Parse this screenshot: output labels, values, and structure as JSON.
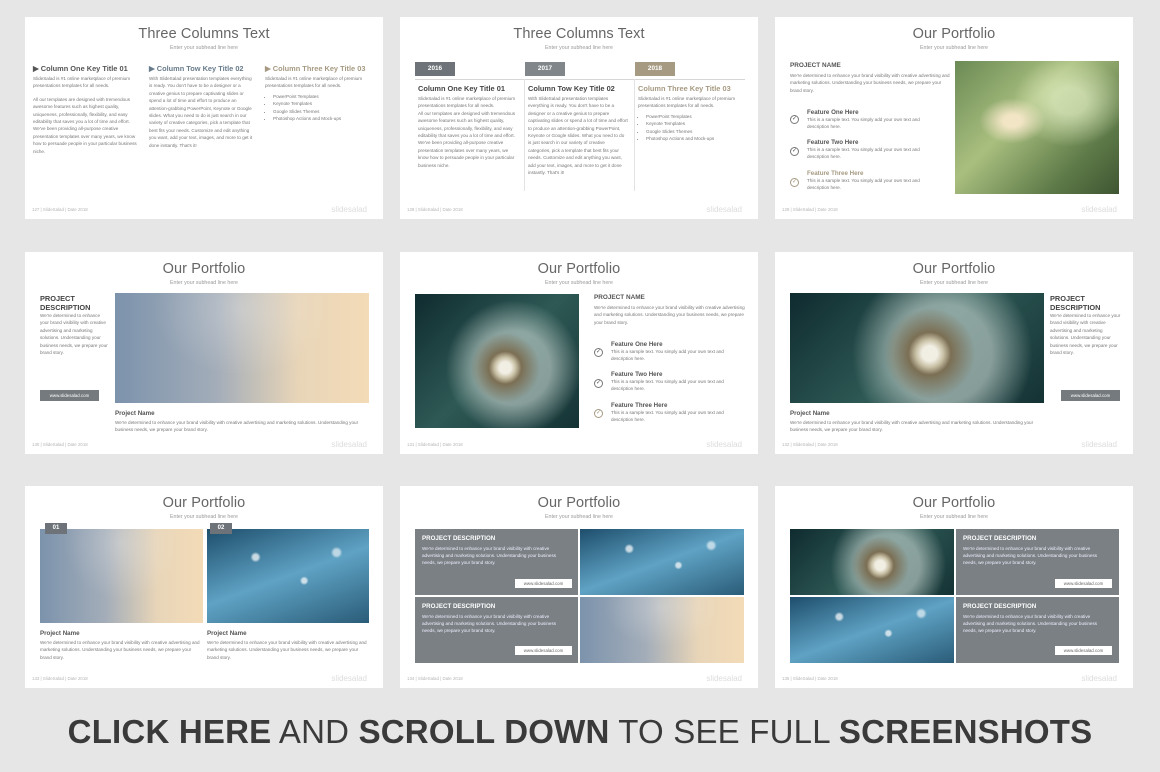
{
  "brand": "slidesalad",
  "footer_1": "127  |  SlideSalad | Date 2018",
  "footer_2": "128  |  SlideSalad | Date 2018",
  "footer_3": "129  |  SlideSalad | Date 2018",
  "footer_4": "130  |  SlideSalad | Date 2018",
  "footer_5": "131  |  SlideSalad | Date 2018",
  "footer_6": "132  |  SlideSalad | Date 2018",
  "footer_7": "133  |  SlideSalad | Date 2018",
  "footer_8": "134  |  SlideSalad | Date 2018",
  "footer_9": "135  |  SlideSalad | Date 2018",
  "subhead": "Enter your subhead line here",
  "title_columns": "Three Columns Text",
  "title_portfolio": "Our Portfolio",
  "col1_title": "Column One Key Title 01",
  "col2_title": "Column Tow Key Title 02",
  "col3_title": "Column Three Key Title 03",
  "col1_text": "SlideSalad is #1 online marketplace of premium presentations templates for all needs.",
  "col1_text2": "All our templates are designed with tremendous awesome features such as highest quality, uniqueness, professionally, flexibility, and easy editability that saves you a lot of time and effort. We've been providing all-purpose creative presentation templates over many years, we know how to persuade people in your particular business niche.",
  "col2_text": "With SlideSalad presentation templates everything is ready. You don't have to be a designer or a creative genius to prepare captivating slides or spend a lot of time and effort to produce an attention-grabbing PowerPoint, Keynote or Google slides. What you need to do is just search in our variety of creative categories, pick a template that best fits your needs. Customize and edit anything you want, add your text, images, and more to get it done instantly. That's it!",
  "col3_text": "SlideSalad is #1 online marketplace of premium presentations templates for all needs.",
  "bullets": [
    "PowerPoint Templates",
    "Keynote Templates",
    "Google Slides Themes",
    "Photoshop Actions and Mock-ups"
  ],
  "years": [
    "2016",
    "2017",
    "2018"
  ],
  "project_name": "PROJECT NAME",
  "project_name_lc": "Project Name",
  "project_desc": "PROJECT DESCRIPTION",
  "project_desc_2": "PROJECT\nDESCRIPTION",
  "desc_text": "We're determined to enhance your brand visibility with creative advertising and marketing solutions. Understanding your business needs, we prepare your brand story.",
  "features": [
    "Feature One Here",
    "Feature Two Here",
    "Feature Three Here"
  ],
  "feature_text": "This is a sample text. You simply add your own text and description here.",
  "url": "www.slidesalad.com",
  "nums": [
    "01",
    "02"
  ],
  "cta": {
    "p1": "CLICK HERE",
    "p2": " AND ",
    "p3": "SCROLL DOWN",
    "p4": " TO SEE FULL ",
    "p5": "SCREENSHOTS"
  }
}
